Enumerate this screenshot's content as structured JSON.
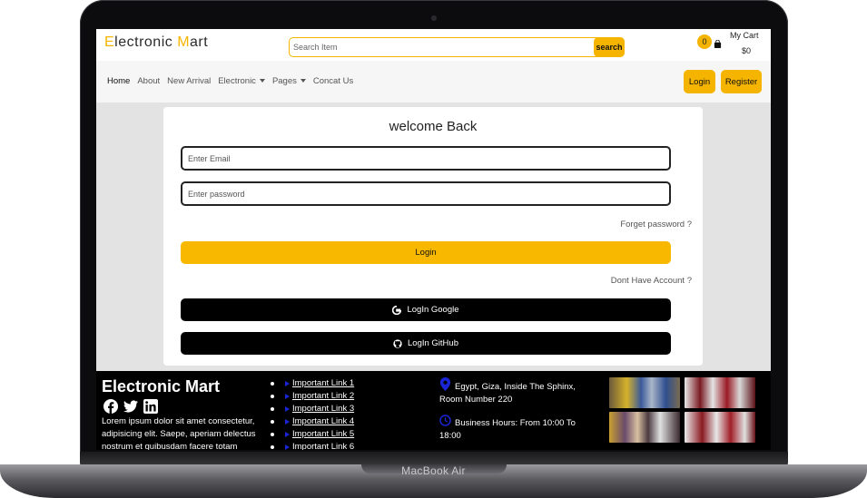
{
  "device": {
    "model_label": "MacBook Air"
  },
  "header": {
    "brand_first_letter": "E",
    "brand_part1": "lectronic ",
    "brand_second_letter": "M",
    "brand_part2": "art",
    "search_placeholder": "Search Item",
    "search_button": "search",
    "cart_count": "0",
    "cart_title": "My Cart",
    "cart_total": "$0"
  },
  "nav": {
    "items": [
      "Home",
      "About",
      "New Arrival",
      "Electronic",
      "Pages",
      "Concat Us"
    ],
    "login": "Login",
    "register": "Register"
  },
  "login_card": {
    "title": "welcome Back",
    "email_placeholder": "Enter Email",
    "password_placeholder": "Enter password",
    "forget_link": "Forget password ?",
    "login_button": "Login",
    "no_account_link": "Dont Have Account ?",
    "google_button": "LogIn Google",
    "github_button": "LogIn GitHub"
  },
  "footer": {
    "brand": "Electronic Mart",
    "description": "Lorem ipsum dolor sit amet consectetur, adipisicing elit. Saepe, aperiam delectus nostrum et quibusdam facere totam",
    "links": [
      "Important Link 1",
      "Important Link 2",
      "Important Link 3",
      "Important Link 4",
      "Important Link 5",
      "Important Link 6"
    ],
    "address": "Egypt, Giza, Inside The Sphinx, Room Number 220",
    "hours": "Business Hours: From 10:00 To 18:00"
  },
  "colors": {
    "accent": "#f5b400",
    "footer_bg": "#000000",
    "link_arrow": "#1a25d6"
  }
}
